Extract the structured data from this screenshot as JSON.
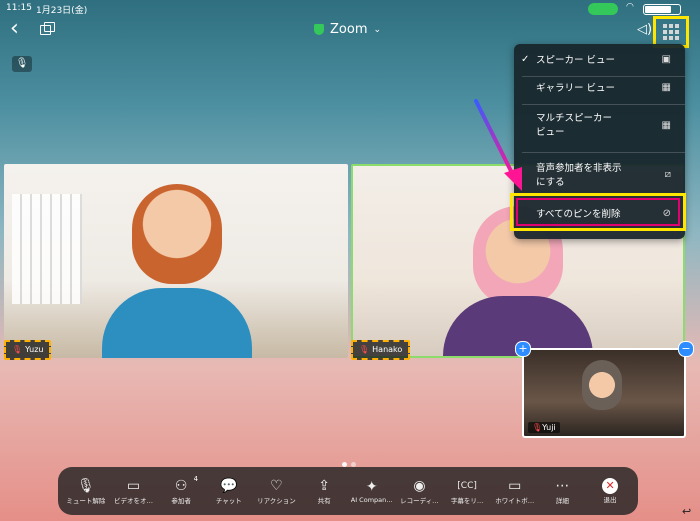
{
  "status_bar": {
    "time": "11:15",
    "date": "1月23日(金)"
  },
  "top_bar": {
    "title": "Zoom"
  },
  "participants": [
    {
      "name": "Yuzu"
    },
    {
      "name": "Hanako"
    },
    {
      "name": "Yuji"
    }
  ],
  "view_menu": {
    "items": [
      {
        "label": "スピーカー ビュー",
        "checked": true,
        "icon": "speaker-view-icon"
      },
      {
        "label": "ギャラリー ビュー",
        "checked": false,
        "icon": "gallery-view-icon"
      },
      {
        "label": "マルチスピーカー",
        "label2": "ビュー",
        "checked": false,
        "icon": "multi-speaker-view-icon"
      },
      {
        "label": "音声参加者を非表示",
        "label2": "にする",
        "checked": false,
        "icon": "hide-video-icon"
      },
      {
        "label": "すべてのピンを削除",
        "checked": false,
        "icon": "unpin-icon"
      }
    ]
  },
  "toolbar": {
    "items": [
      {
        "label": "ミュート解除",
        "icon": "microphone-icon"
      },
      {
        "label": "ビデオをオ…",
        "icon": "video-camera-icon"
      },
      {
        "label": "参加者",
        "icon": "participants-icon",
        "badge": "4"
      },
      {
        "label": "チャット",
        "icon": "chat-icon"
      },
      {
        "label": "リアクション",
        "icon": "heart-icon"
      },
      {
        "label": "共有",
        "icon": "share-icon"
      },
      {
        "label": "AI Compan…",
        "icon": "ai-sparkle-icon"
      },
      {
        "label": "レコーディ…",
        "icon": "record-icon"
      },
      {
        "label": "字幕をリ…",
        "icon": "captions-icon"
      },
      {
        "label": "ホワイトボ…",
        "icon": "whiteboard-icon"
      },
      {
        "label": "詳細",
        "icon": "more-icon"
      },
      {
        "label": "退出",
        "icon": "leave-icon"
      }
    ]
  },
  "colors": {
    "highlight_yellow": "#ffe600",
    "highlight_magenta": "#e0006e",
    "active_speaker_green": "#8bdc6a",
    "leave_red": "#e02828"
  }
}
